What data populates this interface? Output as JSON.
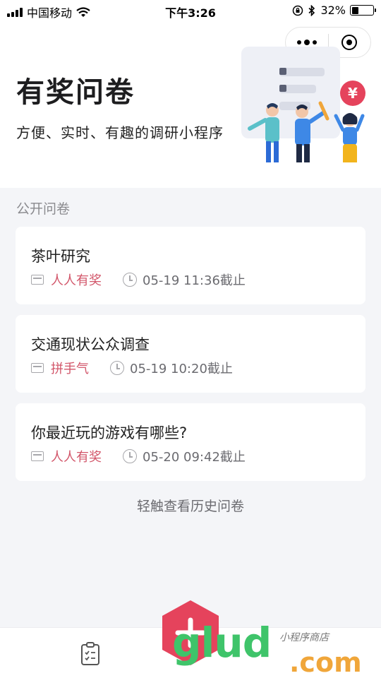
{
  "status_bar": {
    "carrier": "中国移动",
    "time": "下午3:26",
    "battery": "32%",
    "battery_level": 0.32
  },
  "capsule": {
    "more_icon": "more-dots-icon",
    "close_icon": "target-close-icon"
  },
  "hero": {
    "title": "有奖问卷",
    "subtitle": "方便、实时、有趣的调研小程序"
  },
  "section": {
    "label": "公开问卷"
  },
  "surveys": [
    {
      "title": "茶叶研究",
      "tag": "人人有奖",
      "deadline": "05-19 11:36截止"
    },
    {
      "title": "交通现状公众调查",
      "tag": "拼手气",
      "deadline": "05-19 10:20截止"
    },
    {
      "title": "你最近玩的游戏有哪些?",
      "tag": "人人有奖",
      "deadline": "05-20 09:42截止"
    }
  ],
  "history_link": "轻触查看历史问卷",
  "tabbar": {
    "list_icon": "clipboard-icon",
    "create_icon": "plus-hexagon-icon"
  },
  "watermark": {
    "brand": "glud",
    "domain": ".com",
    "tagline": "小程序商店"
  },
  "colors": {
    "accent": "#d2566a",
    "fab": "#e5435c",
    "background": "#f4f5f8"
  }
}
